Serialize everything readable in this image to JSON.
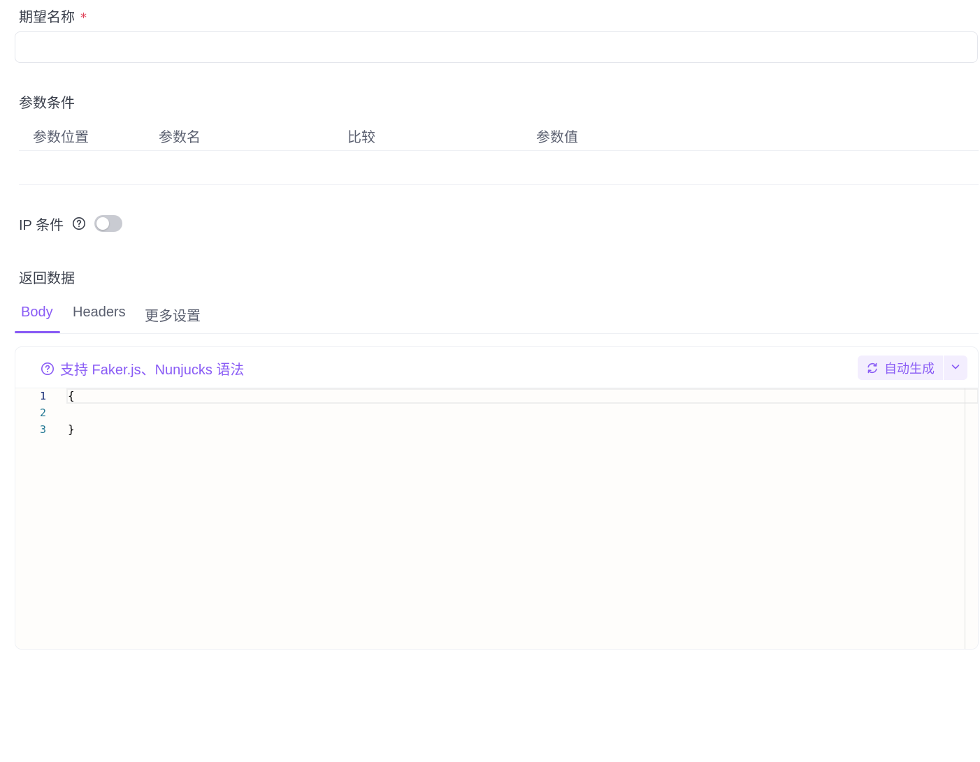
{
  "form": {
    "name_label": "期望名称",
    "required_mark": "*",
    "name_value": "",
    "name_placeholder": ""
  },
  "params": {
    "section_label": "参数条件",
    "columns": [
      "参数位置",
      "参数名",
      "比较",
      "参数值"
    ],
    "rows": []
  },
  "ip": {
    "label": "IP 条件",
    "help_icon": "question-circle-icon",
    "toggle_on": false
  },
  "response": {
    "section_label": "返回数据",
    "tabs": [
      {
        "label": "Body",
        "active": true
      },
      {
        "label": "Headers",
        "active": false
      },
      {
        "label": "更多设置",
        "active": false
      }
    ],
    "syntax_hint": "支持 Faker.js、Nunjucks 语法",
    "syntax_hint_icon": "question-circle-icon",
    "auto_generate_label": "自动生成",
    "auto_generate_icon": "refresh-icon",
    "dropdown_icon": "chevron-down-icon"
  },
  "editor": {
    "line_numbers": [
      "1",
      "2",
      "3"
    ],
    "lines": [
      "{",
      "",
      "}"
    ]
  },
  "colors": {
    "accent": "#8a5cf5",
    "required": "#e0445a",
    "toggle_off": "#c9cbd2"
  }
}
